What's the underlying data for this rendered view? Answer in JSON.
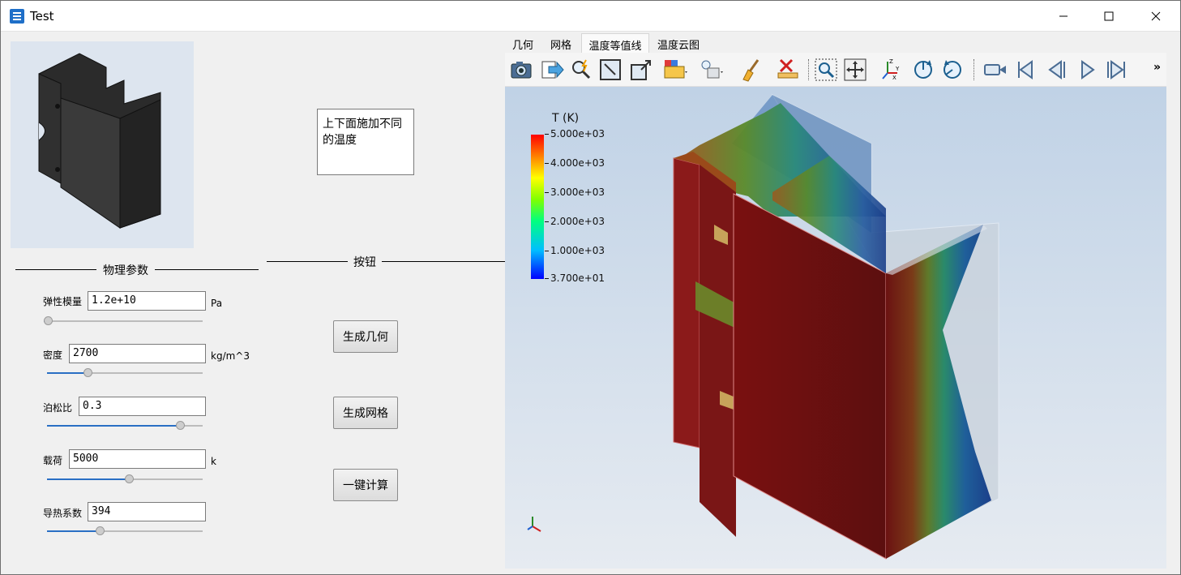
{
  "window": {
    "title": "Test"
  },
  "note_text": "上下面施加不同的温度",
  "groups": {
    "physics": "物理参数",
    "buttons": "按钮"
  },
  "params": [
    {
      "label": "弹性模量",
      "value": "1.2e+10",
      "unit": "Pa",
      "slider_fraction": 0.0
    },
    {
      "label": "密度",
      "value": "2700",
      "unit": "kg/m^3",
      "slider_fraction": 0.25
    },
    {
      "label": "泊松比",
      "value": "0.3",
      "unit": "",
      "slider_fraction": 0.88
    },
    {
      "label": "载荷",
      "value": "5000",
      "unit": "k",
      "slider_fraction": 0.53
    },
    {
      "label": "导热系数",
      "value": "394",
      "unit": "",
      "slider_fraction": 0.33
    }
  ],
  "buttons": {
    "gen_geometry": "生成几何",
    "gen_mesh": "生成网格",
    "compute": "一键计算"
  },
  "tabs": [
    "几何",
    "网格",
    "温度等值线",
    "温度云图"
  ],
  "active_tab": 2,
  "toolbar_icons": [
    "camera-icon",
    "export-icon",
    "query-icon",
    "zoom-box-icon",
    "fit-view-icon",
    "color-select-icon",
    "light-icon",
    "clear-icon",
    "delete-icon",
    "zoom-region-icon",
    "pan-icon",
    "axes-icon",
    "rotate-cw-icon",
    "rotate-ccw-icon",
    "video-icon",
    "first-frame-icon",
    "prev-frame-icon",
    "play-icon",
    "last-frame-icon"
  ],
  "toolbar_more": "»",
  "colors": {
    "accent": "#2a6fc4",
    "hot": "#8b1010",
    "cold": "#1b3f8a"
  },
  "legend": {
    "title": "T (K)",
    "ticks": [
      "5.000e+03",
      "4.000e+03",
      "3.000e+03",
      "2.000e+03",
      "1.000e+03",
      "3.700e+01"
    ]
  }
}
